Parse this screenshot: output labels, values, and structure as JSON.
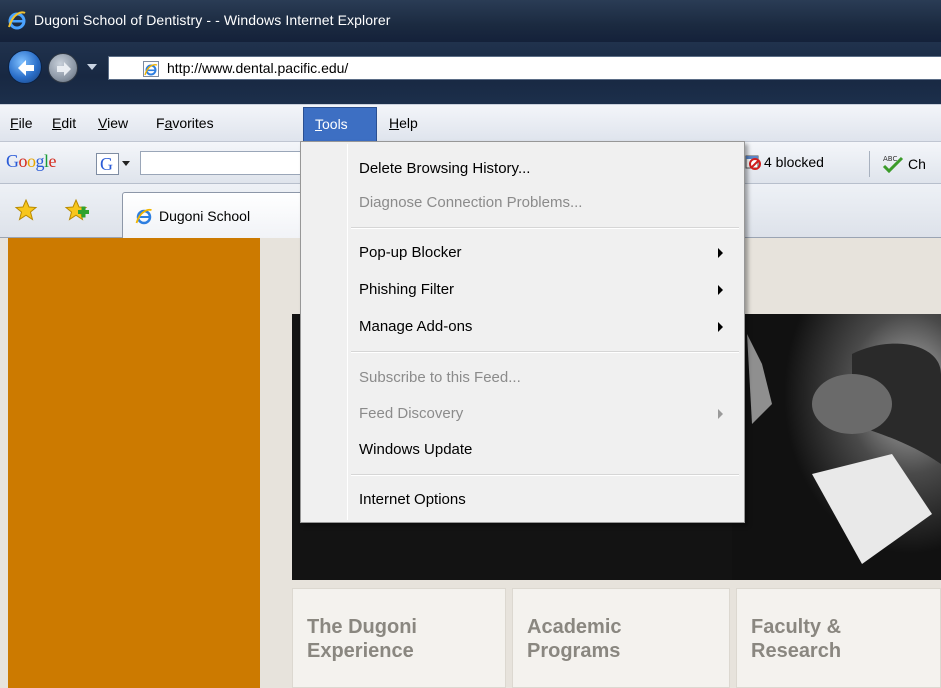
{
  "window": {
    "title": "Dugoni School of Dentistry - - Windows Internet Explorer",
    "address_url": "http://www.dental.pacific.edu/"
  },
  "menubar": {
    "items": [
      "File",
      "Edit",
      "View",
      "Favorites",
      "Tools",
      "Help"
    ],
    "active": "Tools"
  },
  "google_toolbar": {
    "logo_text": "Google",
    "logo_colors": [
      "#2a5bd7",
      "#d42b1e",
      "#e8a400",
      "#2a5bd7",
      "#1a9c37",
      "#d42b1e"
    ],
    "popup_blocked_label": "4 blocked",
    "spellcheck_label": "Ch",
    "spellcheck_icon_text": "ABC"
  },
  "tabs": {
    "active_tab_label": "Dugoni School"
  },
  "tools_menu": {
    "items": [
      {
        "label": "Delete Browsing History...",
        "enabled": true,
        "submenu": false
      },
      {
        "label": "Diagnose Connection Problems...",
        "enabled": false,
        "submenu": false
      },
      {
        "label": "Pop-up Blocker",
        "enabled": true,
        "submenu": true
      },
      {
        "label": "Phishing Filter",
        "enabled": true,
        "submenu": true
      },
      {
        "label": "Manage Add-ons",
        "enabled": true,
        "submenu": true
      },
      {
        "label": "Subscribe to this Feed...",
        "enabled": false,
        "submenu": false
      },
      {
        "label": "Feed Discovery",
        "enabled": false,
        "submenu": true
      },
      {
        "label": "Windows Update",
        "enabled": true,
        "submenu": false
      },
      {
        "label": "Internet Options",
        "enabled": true,
        "submenu": false
      }
    ]
  },
  "page": {
    "nav_tiles": [
      {
        "line1": "The Dugoni",
        "line2": "Experience"
      },
      {
        "line1": "Academic",
        "line2": "Programs"
      },
      {
        "line1": "Faculty &",
        "line2": "Research"
      }
    ],
    "accent_color": "#cc7a00"
  },
  "icons": {
    "ie_logo": "ie-logo-icon",
    "back": "back-arrow-icon",
    "forward": "forward-arrow-icon",
    "favorites_star": "favorites-star-icon",
    "add_favorite": "add-favorite-icon",
    "popup_blocked": "popup-blocked-icon",
    "spellcheck": "spellcheck-icon"
  }
}
